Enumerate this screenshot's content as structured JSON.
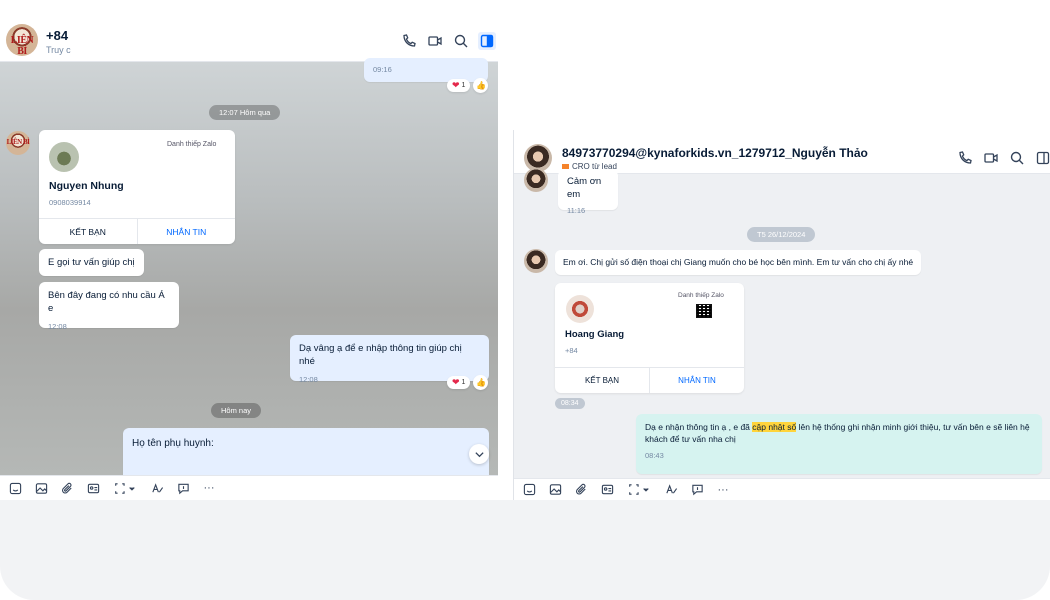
{
  "left": {
    "header": {
      "name": "+84",
      "sub": "Truy c",
      "avatar_text": "LIÊN BÌ"
    },
    "messages": {
      "top_time": "09:16",
      "top_react_count": "1",
      "divider_yesterday": "12:07 Hôm qua",
      "card": {
        "tag": "Danh thiếp Zalo",
        "name": "Nguyen Nhung",
        "phone": "0908039914",
        "btn_add": "KẾT BẠN",
        "btn_msg": "NHẮN TIN"
      },
      "m1": "E gọi tư vấn giúp chị",
      "m2": "Bên đây đang có nhu cầu Á e",
      "m2_time": "12:08",
      "m3": "Dạ vâng ạ để e nhập thông tin giúp chị nhé",
      "m3_time": "12:08",
      "m3_react_count": "1",
      "divider_today": "Hôm nay",
      "m4": "Họ tên phụ huynh:"
    }
  },
  "right": {
    "header": {
      "name": "84973770294@kynaforkids.vn_1279712_Nguyễn Thảo",
      "tag": "CRO từ lead"
    },
    "messages": {
      "m0": "Cảm ơn em",
      "m0_time": "11:16",
      "divider": "T5 26/12/2024",
      "m1": "Em ơi. Chị gửi số điện thoại chị Giang muốn cho bé học bên mình. Em tư vấn cho chị ấy nhé",
      "card": {
        "tag": "Danh thiếp Zalo",
        "name": "Hoang Giang",
        "phone": "+84",
        "btn_add": "KẾT BẠN",
        "btn_msg": "NHẮN TIN",
        "time": "08:34"
      },
      "m2_a": "Dạ e nhận thông tin ạ , e đã ",
      "m2_hl": "cập nhật số",
      "m2_b": " lên hệ thống ghi nhận minh giới thiệu, tư vấn bên e sẽ liên hệ khách để tư vấn nha chị",
      "m2_time": "08:43"
    }
  },
  "icons": [
    "phone-icon",
    "video-icon",
    "search-icon",
    "sidebar-toggle-icon",
    "sticker-icon",
    "image-icon",
    "attach-icon",
    "contact-card-icon",
    "screenshot-icon",
    "format-text-icon",
    "quick-message-icon",
    "more-icon"
  ],
  "toolbar": {
    "more": "···"
  },
  "colors": {
    "accent": "#0068ff",
    "mine_bubble": "#e5efff",
    "highlight": "#ffd43b",
    "heart": "#e4284b"
  }
}
